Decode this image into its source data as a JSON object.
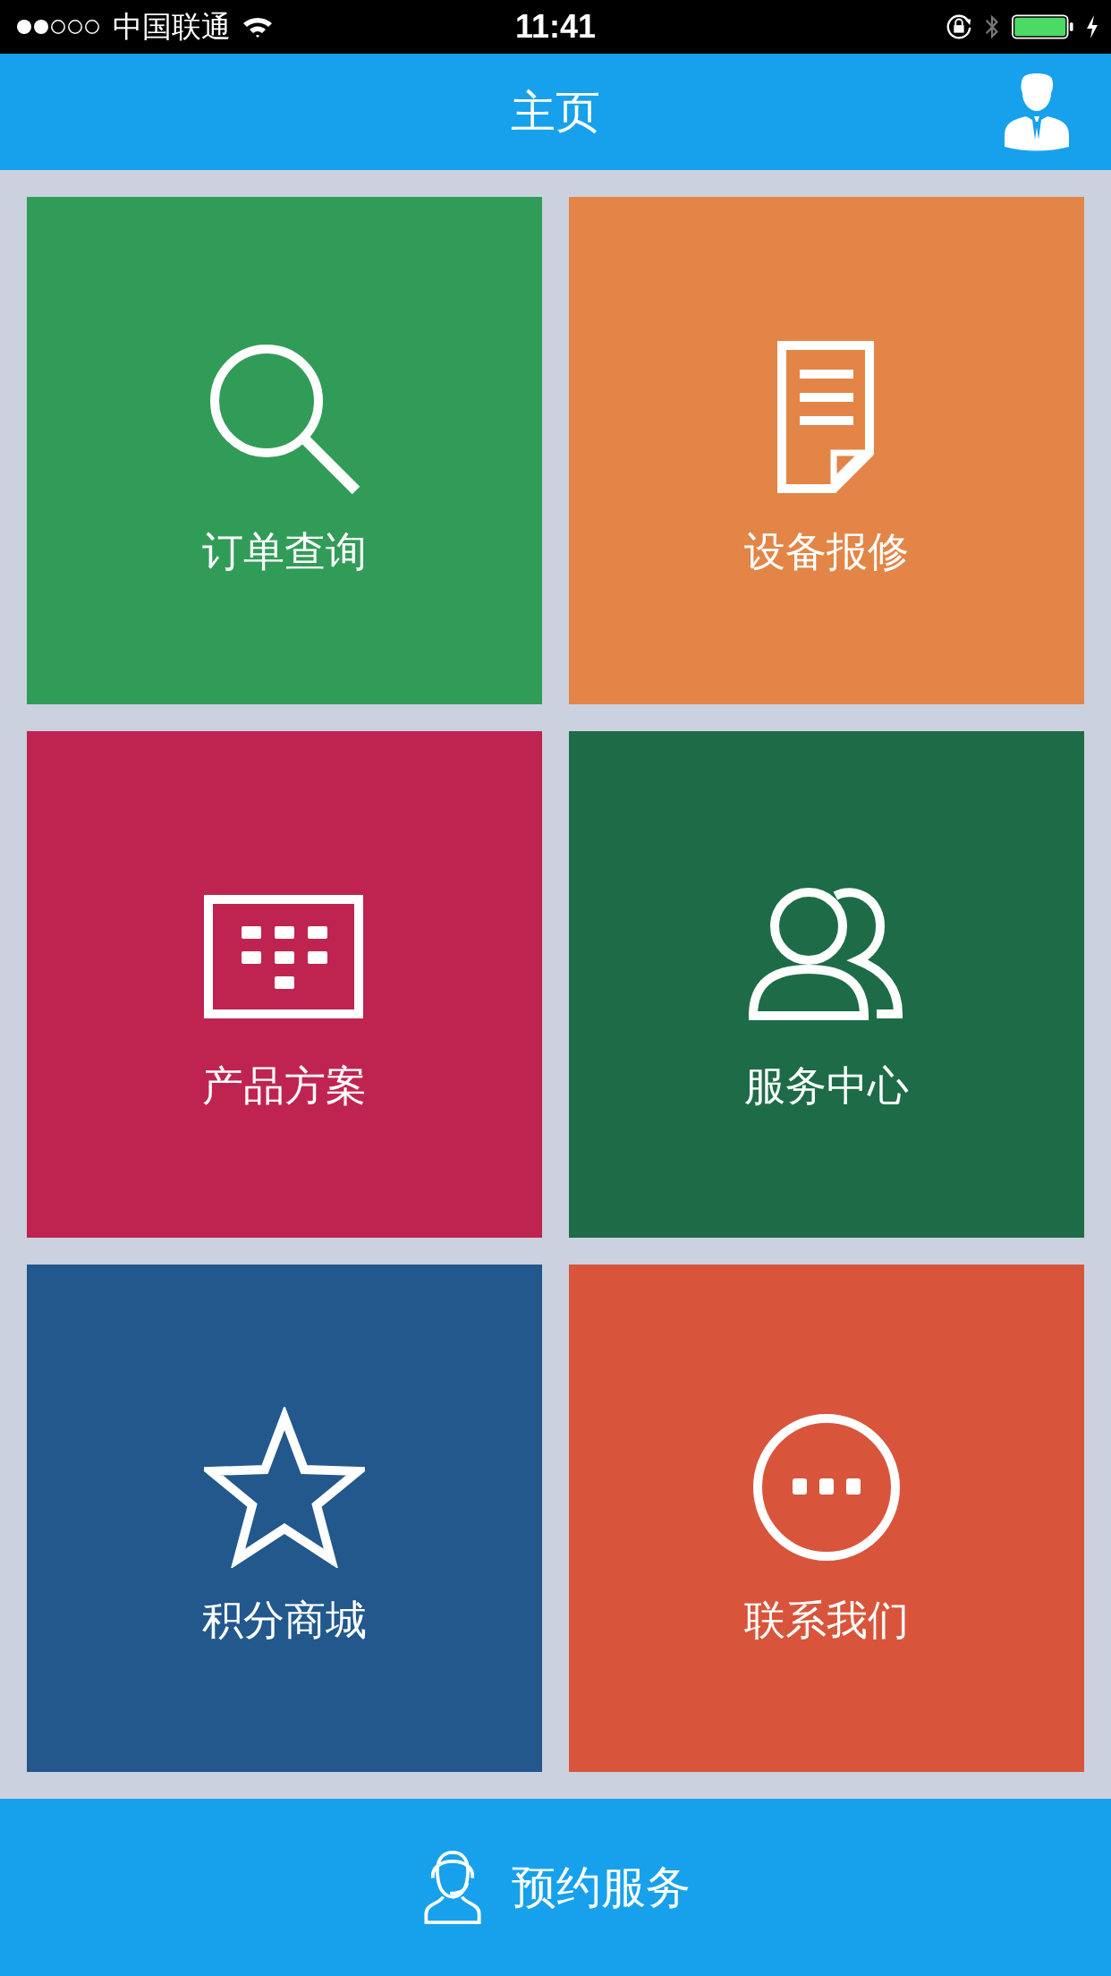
{
  "status_bar": {
    "carrier": "中国联通",
    "time": "11:41"
  },
  "header": {
    "title": "主页"
  },
  "tiles": [
    {
      "label": "订单查询",
      "kind": "search",
      "color": "#319c58"
    },
    {
      "label": "设备报修",
      "kind": "document",
      "color": "#e38547"
    },
    {
      "label": "产品方案",
      "kind": "keypad",
      "color": "#bf2450"
    },
    {
      "label": "服务中心",
      "kind": "people",
      "color": "#1d6c47"
    },
    {
      "label": "积分商城",
      "kind": "star",
      "color": "#22588c"
    },
    {
      "label": "联系我们",
      "kind": "chat",
      "color": "#d8553b"
    }
  ],
  "bottom_button": {
    "label": "预约服务"
  }
}
